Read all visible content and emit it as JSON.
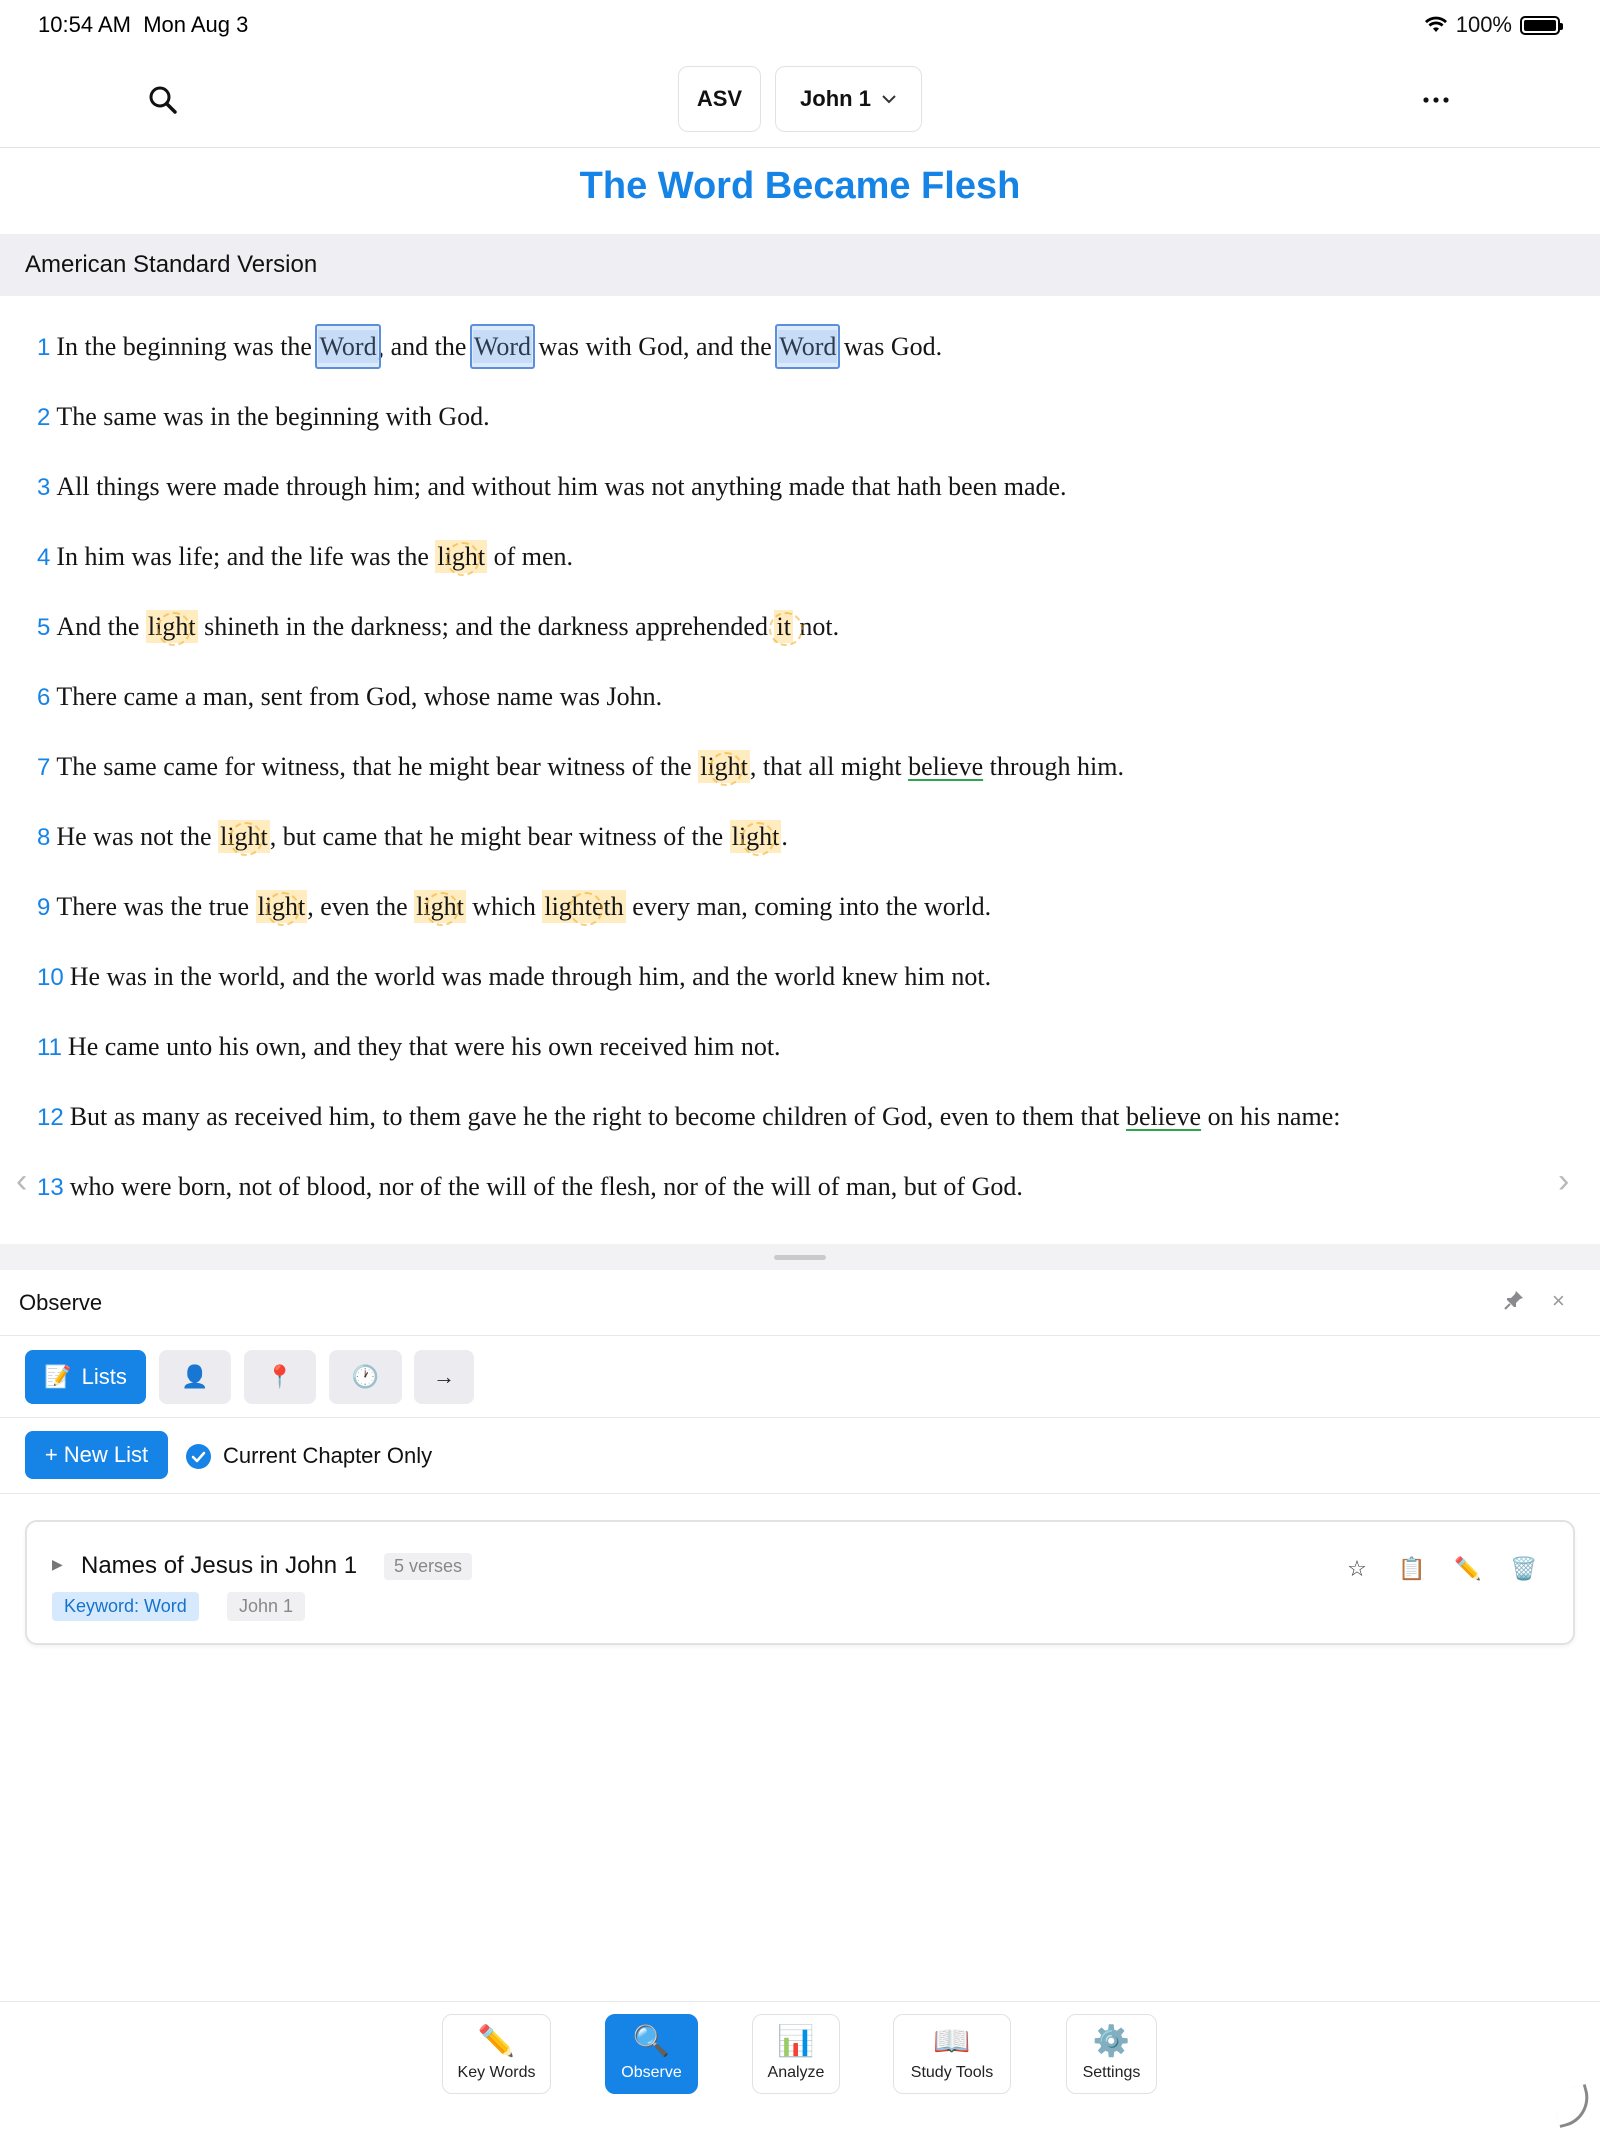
{
  "status": {
    "time": "10:54 AM",
    "date": "Mon Aug 3",
    "battery": "100%"
  },
  "toolbar": {
    "version": "ASV",
    "chapter": "John 1"
  },
  "reading": {
    "title": "The Word Became Flesh",
    "version_name": "American Standard Version",
    "verses": [
      {
        "n": "1",
        "parts": [
          {
            "t": "In the beginning was the "
          },
          {
            "t": "Word",
            "k": "word"
          },
          {
            "t": ", and the "
          },
          {
            "t": "Word",
            "k": "word"
          },
          {
            "t": " was with God, and the "
          },
          {
            "t": "Word",
            "k": "word"
          },
          {
            "t": " was God."
          }
        ]
      },
      {
        "n": "2",
        "parts": [
          {
            "t": "The same was in the beginning with God."
          }
        ]
      },
      {
        "n": "3",
        "parts": [
          {
            "t": "All things were made through him; and without him was not anything made that hath been made."
          }
        ]
      },
      {
        "n": "4",
        "parts": [
          {
            "t": "In him was life; and the life was the "
          },
          {
            "t": "light",
            "k": "light"
          },
          {
            "t": " of men."
          }
        ]
      },
      {
        "n": "5",
        "parts": [
          {
            "t": "And the "
          },
          {
            "t": "light",
            "k": "light"
          },
          {
            "t": " shineth in the darkness; and the darkness apprehended "
          },
          {
            "t": "it",
            "k": "light"
          },
          {
            "t": " not."
          }
        ]
      },
      {
        "n": "6",
        "parts": [
          {
            "t": "There came a man, sent from God, whose name was John."
          }
        ]
      },
      {
        "n": "7",
        "parts": [
          {
            "t": "The same came for witness, that he might bear witness of the "
          },
          {
            "t": "light",
            "k": "light"
          },
          {
            "t": ", that all might "
          },
          {
            "t": "believe",
            "k": "believe"
          },
          {
            "t": " through him."
          }
        ]
      },
      {
        "n": "8",
        "parts": [
          {
            "t": "He was not the "
          },
          {
            "t": "light",
            "k": "light"
          },
          {
            "t": ", but came that he might bear witness of the "
          },
          {
            "t": "light",
            "k": "light"
          },
          {
            "t": "."
          }
        ]
      },
      {
        "n": "9",
        "parts": [
          {
            "t": "There was the true "
          },
          {
            "t": "light",
            "k": "light"
          },
          {
            "t": ", even the "
          },
          {
            "t": "light",
            "k": "light"
          },
          {
            "t": " which "
          },
          {
            "t": "lighteth",
            "k": "light"
          },
          {
            "t": " every man, coming into the world."
          }
        ]
      },
      {
        "n": "10",
        "parts": [
          {
            "t": "He was in the world, and the world was made through him, and the world knew him not."
          }
        ]
      },
      {
        "n": "11",
        "parts": [
          {
            "t": "He came unto his own, and they that were his own received him not."
          }
        ]
      },
      {
        "n": "12",
        "parts": [
          {
            "t": "But as many as received him, to them gave he the right to become children of God, even to them that "
          },
          {
            "t": "believe",
            "k": "believe"
          },
          {
            "t": " on his name:"
          }
        ]
      },
      {
        "n": "13",
        "parts": [
          {
            "t": "who were born, not of blood, nor of the will of the flesh, nor of the will of man, but of God."
          }
        ]
      }
    ]
  },
  "panel": {
    "title": "Observe",
    "tabs": {
      "lists_label": "Lists"
    },
    "new_list_label": "+ New List",
    "current_chapter_label": "Current Chapter Only",
    "list": {
      "name": "Names of Jesus in John 1",
      "count": "5 verses",
      "keyword_tag": "Keyword: Word",
      "scope_tag": "John 1"
    }
  },
  "bottom_tabs": {
    "key_words": "Key Words",
    "observe": "Observe",
    "analyze": "Analyze",
    "study_tools": "Study Tools",
    "settings": "Settings"
  },
  "colors": {
    "accent": "#1683e6",
    "light_highlight": "#ffe7a8",
    "word_highlight": "#5b8fdc",
    "believe_underline": "#2ea44f"
  },
  "icons": {
    "search": "magnifier-icon",
    "more": "ellipsis-icon",
    "lists": "memo-icon",
    "people": "person-silhouette-icon",
    "places": "pushpin-icon",
    "time": "clock-icon",
    "next": "arrow-right-icon",
    "star": "star-icon",
    "copy": "clipboard-icon",
    "edit": "pencil-icon",
    "delete": "wastebasket-icon"
  }
}
